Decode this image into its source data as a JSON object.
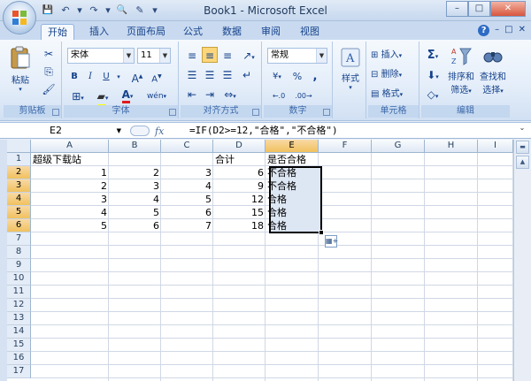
{
  "window": {
    "title": "Book1 - Microsoft Excel",
    "controls": {
      "minimize": "–",
      "maximize": "□",
      "close": "✕"
    }
  },
  "quick_access": {
    "save": "💾",
    "undo": "↶",
    "undo_dd": "▾",
    "redo": "↷",
    "redo_dd": "▾",
    "preview": "🔍",
    "tools": "✎",
    "more": "▾"
  },
  "tabs": [
    {
      "label": "开始",
      "active": true
    },
    {
      "label": "插入",
      "active": false
    },
    {
      "label": "页面布局",
      "active": false
    },
    {
      "label": "公式",
      "active": false
    },
    {
      "label": "数据",
      "active": false
    },
    {
      "label": "审阅",
      "active": false
    },
    {
      "label": "视图",
      "active": false
    }
  ],
  "tab_right": {
    "help": "?",
    "min": "–",
    "restore": "□",
    "close": "✕"
  },
  "ribbon": {
    "clipboard": {
      "label": "剪贴板",
      "paste": "粘贴",
      "paste_dd": "▾"
    },
    "font": {
      "label": "字体",
      "font_name": "宋体",
      "font_size": "11",
      "bold": "B",
      "italic": "I",
      "underline": "U",
      "grow": "A",
      "shrink": "A",
      "color_letter": "A",
      "phonetic": "wén"
    },
    "alignment": {
      "label": "对齐方式"
    },
    "number": {
      "label": "数字",
      "format": "常规",
      "percent": "%",
      "comma": ",",
      "currency": "¥"
    },
    "styles": {
      "label": "样式"
    },
    "cells": {
      "label": "单元格",
      "insert": "插入",
      "delete": "删除",
      "format": "格式"
    },
    "editing": {
      "label": "编辑",
      "sort": "排序和",
      "sort2": "筛选",
      "find": "查找和",
      "find2": "选择",
      "sum": "Σ"
    }
  },
  "formula_bar": {
    "name_box": "E2",
    "fx": "fx",
    "formula": "=IF(D2>=12,\"合格\",\"不合格\")"
  },
  "columns": [
    "A",
    "B",
    "C",
    "D",
    "E",
    "F",
    "G",
    "H",
    "I"
  ],
  "rows": [
    "1",
    "2",
    "3",
    "4",
    "5",
    "6",
    "7",
    "8",
    "9",
    "10",
    "11",
    "12",
    "13",
    "14",
    "15",
    "16",
    "17"
  ],
  "cells": {
    "A1": "超级下载站",
    "D1": "合计",
    "E1": "是否合格",
    "A2": "1",
    "B2": "2",
    "C2": "3",
    "D2": "6",
    "E2": "不合格",
    "A3": "2",
    "B3": "3",
    "C3": "4",
    "D3": "9",
    "E3": "不合格",
    "A4": "3",
    "B4": "4",
    "C4": "5",
    "D4": "12",
    "E4": "合格",
    "A5": "4",
    "B5": "5",
    "C5": "6",
    "D5": "15",
    "E5": "合格",
    "A6": "5",
    "B6": "6",
    "C6": "7",
    "D6": "18",
    "E6": "合格"
  },
  "selection": {
    "active": "E2",
    "range": "E2:E6"
  },
  "colors": {
    "accent": "#15428b",
    "ribbon_bg": "#dfeaf7",
    "selected_header": "#f1c15f"
  }
}
